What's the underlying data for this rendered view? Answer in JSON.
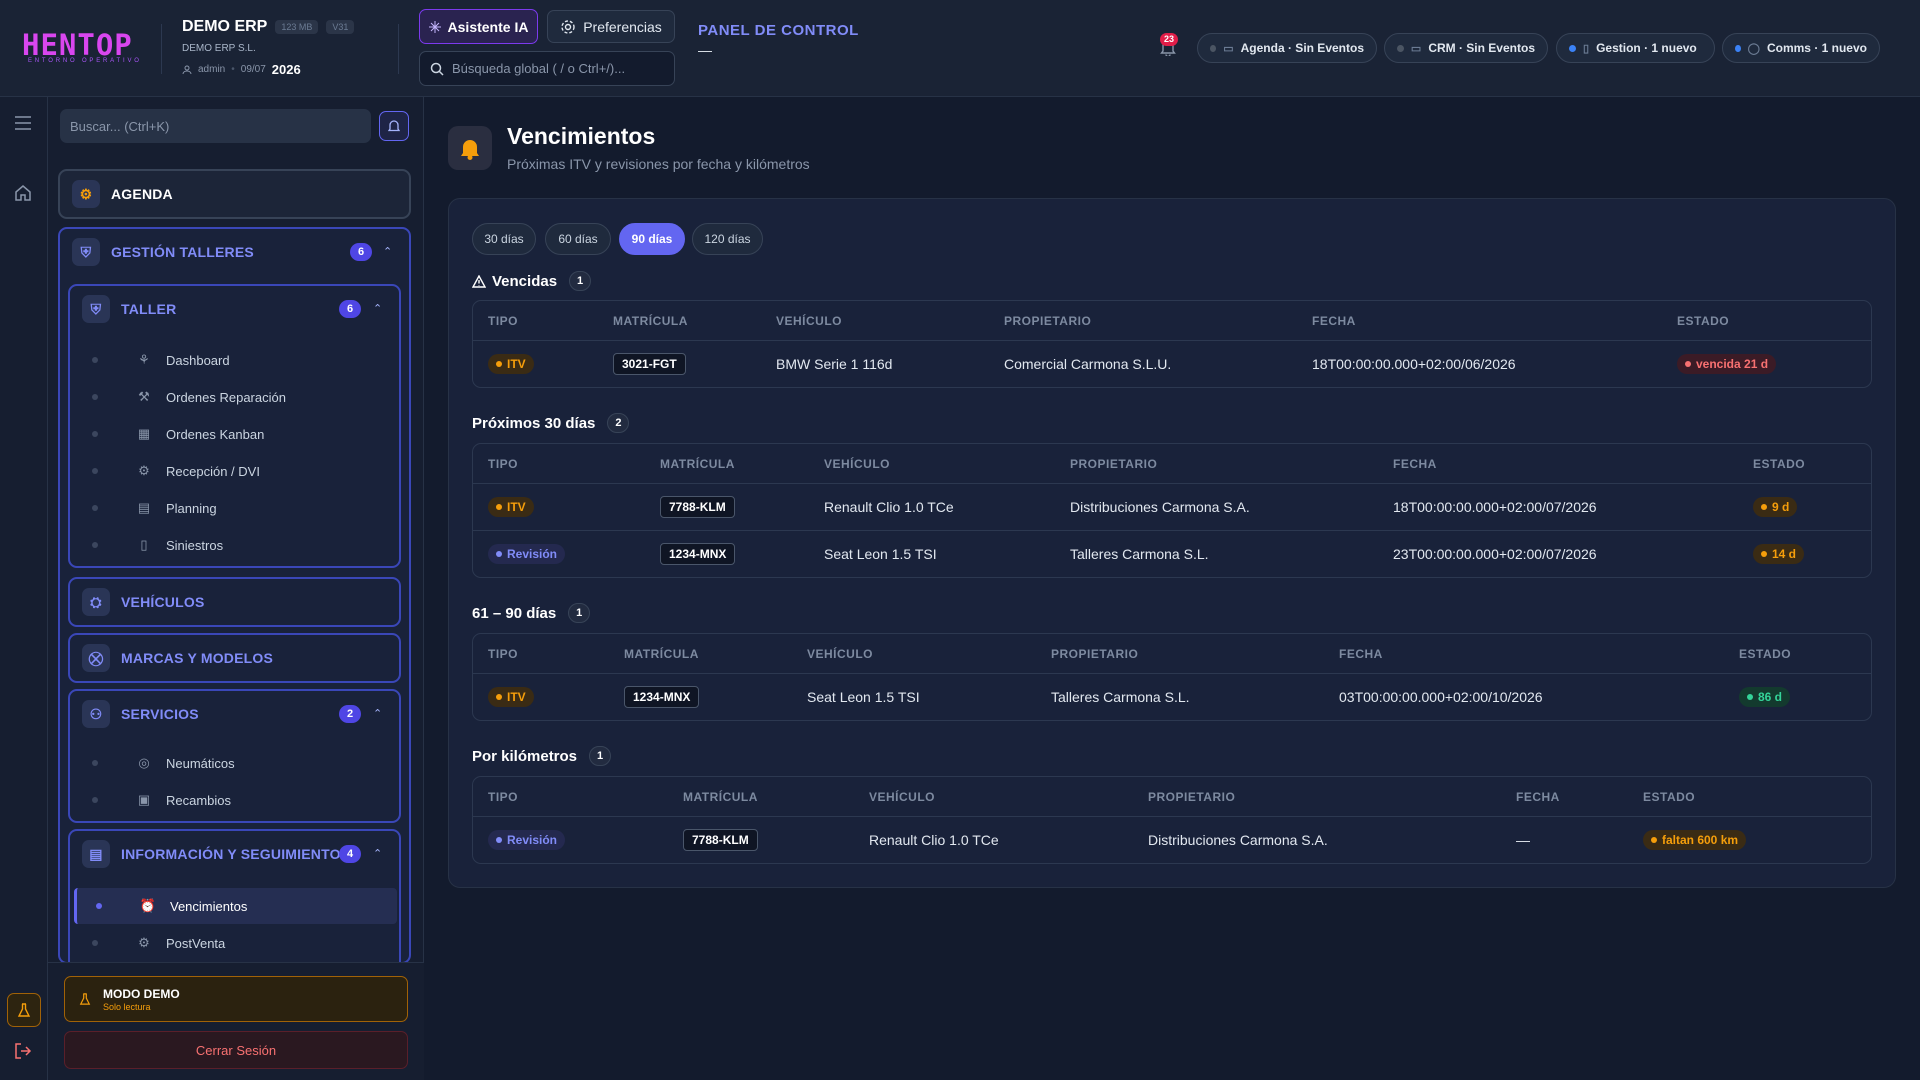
{
  "header": {
    "logo": "HENTOP",
    "logo_sub": "ENTORNO OPERATIVO",
    "company_name": "DEMO ERP",
    "size_tag": "123 MB",
    "version_tag": "V31",
    "company_legal": "DEMO ERP S.L.",
    "user": "admin",
    "date": "09/07",
    "year": "2026",
    "ai_button": "Asistente IA",
    "prefs_button": "Preferencias",
    "search_placeholder": "Búsqueda global ( / o Ctrl+/)...",
    "panel_title": "PANEL DE CONTROL",
    "panel_sub": "—",
    "notif_count": "23",
    "pills": [
      {
        "label": "Agenda · Sin Eventos",
        "dot": "#4b5563",
        "icon": "calendar-icon"
      },
      {
        "label": "CRM · Sin Eventos",
        "dot": "#4b5563",
        "icon": "chat-icon"
      },
      {
        "label": "Gestion · 1 nuevo",
        "dot": "#3b82f6",
        "icon": "document-icon"
      },
      {
        "label": "Comms · 1 nuevo",
        "dot": "#3b82f6",
        "icon": "message-icon"
      }
    ]
  },
  "sidebar": {
    "search_placeholder": "Buscar... (Ctrl+K)",
    "agenda": "AGENDA",
    "gestion": {
      "label": "GESTIÓN TALLERES",
      "count": "6"
    },
    "taller": {
      "label": "TALLER",
      "count": "6",
      "items": [
        "Dashboard",
        "Ordenes Reparación",
        "Ordenes Kanban",
        "Recepción / DVI",
        "Planning",
        "Siniestros"
      ]
    },
    "vehiculos": "VEHÍCULOS",
    "marcas": "MARCAS Y MODELOS",
    "servicios": {
      "label": "SERVICIOS",
      "count": "2",
      "items": [
        "Neumáticos",
        "Recambios"
      ]
    },
    "info": {
      "label": "INFORMACIÓN Y SEGUIMIENTO",
      "count": "4",
      "items": [
        "Vencimientos",
        "PostVenta"
      ]
    },
    "demo_title": "MODO DEMO",
    "demo_sub": "Solo lectura",
    "logout": "Cerrar Sesión"
  },
  "main": {
    "title": "Vencimientos",
    "subtitle": "Próximas ITV y revisiones por fecha y kilómetros",
    "tabs": [
      "30 días",
      "60 días",
      "90 días",
      "120 días"
    ],
    "active_tab": "90 días",
    "columns": [
      "TIPO",
      "MATRÍCULA",
      "VEHÍCULO",
      "PROPIETARIO",
      "FECHA",
      "ESTADO"
    ],
    "sections": [
      {
        "title": "Vencidas",
        "count": "1",
        "rows": [
          {
            "tipo": "ITV",
            "matricula": "3021-FGT",
            "vehiculo": "BMW Serie 1 116d",
            "propietario": "Comercial Carmona S.L.U.",
            "fecha": "18T00:00:00.000+02:00/06/2026",
            "estado": "vencida 21 d"
          }
        ]
      },
      {
        "title": "Próximos 30 días",
        "count": "2",
        "rows": [
          {
            "tipo": "ITV",
            "matricula": "7788-KLM",
            "vehiculo": "Renault Clio 1.0 TCe",
            "propietario": "Distribuciones Carmona S.A.",
            "fecha": "18T00:00:00.000+02:00/07/2026",
            "estado": "9 d"
          },
          {
            "tipo": "Revisión",
            "matricula": "1234-MNX",
            "vehiculo": "Seat Leon 1.5 TSI",
            "propietario": "Talleres Carmona S.L.",
            "fecha": "23T00:00:00.000+02:00/07/2026",
            "estado": "14 d"
          }
        ]
      },
      {
        "title": "61 – 90 días",
        "count": "1",
        "rows": [
          {
            "tipo": "ITV",
            "matricula": "1234-MNX",
            "vehiculo": "Seat Leon 1.5 TSI",
            "propietario": "Talleres Carmona S.L.",
            "fecha": "03T00:00:00.000+02:00/10/2026",
            "estado": "86 d"
          }
        ]
      },
      {
        "title": "Por kilómetros",
        "count": "1",
        "rows": [
          {
            "tipo": "Revisión",
            "matricula": "7788-KLM",
            "vehiculo": "Renault Clio 1.0 TCe",
            "propietario": "Distribuciones Carmona S.A.",
            "fecha": "—",
            "estado": "faltan 600 km"
          }
        ]
      }
    ]
  }
}
